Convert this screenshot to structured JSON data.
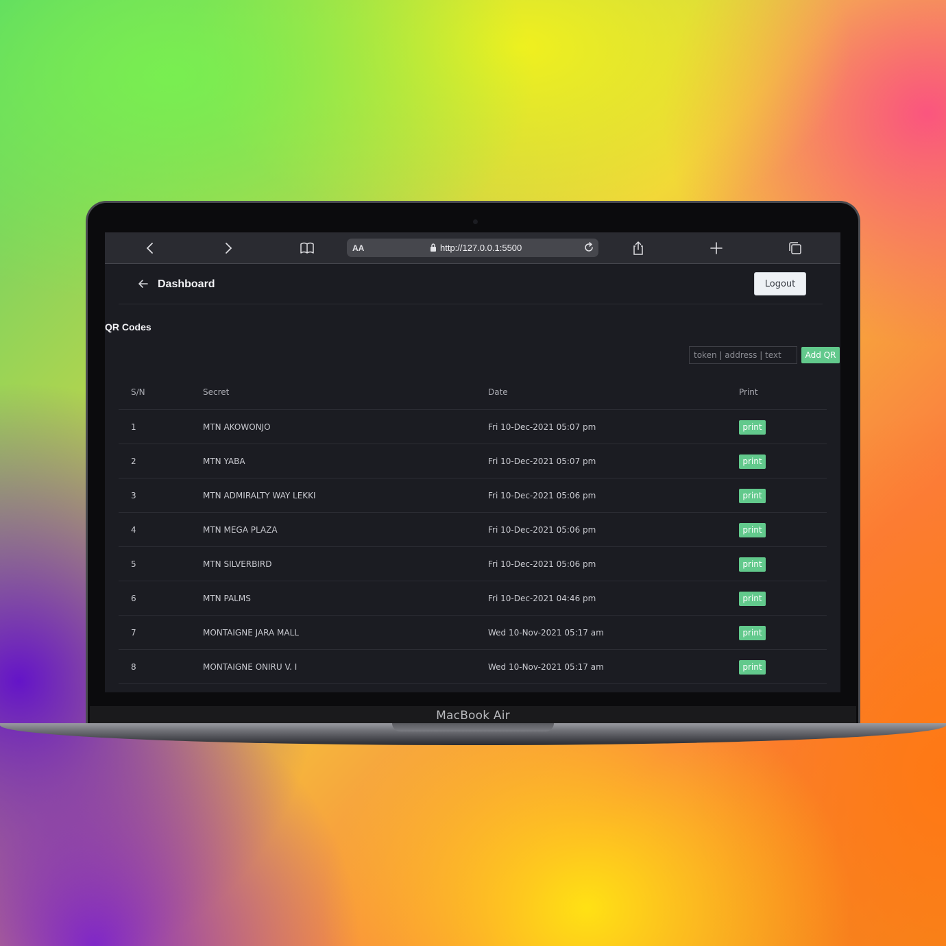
{
  "device": {
    "brand_label": "MacBook Air"
  },
  "browser": {
    "text_size_label": "AA",
    "url": "http://127.0.0.1:5500"
  },
  "header": {
    "title": "Dashboard",
    "logout_label": "Logout"
  },
  "section": {
    "title": "QR Codes"
  },
  "form": {
    "placeholder": "token | address | text",
    "add_label": "Add QR"
  },
  "table": {
    "columns": [
      "S/N",
      "Secret",
      "Date",
      "Print"
    ],
    "rows": [
      {
        "sn": "1",
        "secret": "MTN AKOWONJO",
        "date": "Fri 10-Dec-2021 05:07 pm",
        "print": "print"
      },
      {
        "sn": "2",
        "secret": "MTN YABA",
        "date": "Fri 10-Dec-2021 05:07 pm",
        "print": "print"
      },
      {
        "sn": "3",
        "secret": "MTN ADMIRALTY WAY LEKKI",
        "date": "Fri 10-Dec-2021 05:06 pm",
        "print": "print"
      },
      {
        "sn": "4",
        "secret": "MTN MEGA PLAZA",
        "date": "Fri 10-Dec-2021 05:06 pm",
        "print": "print"
      },
      {
        "sn": "5",
        "secret": "MTN SILVERBIRD",
        "date": "Fri 10-Dec-2021 05:06 pm",
        "print": "print"
      },
      {
        "sn": "6",
        "secret": "MTN PALMS",
        "date": "Fri 10-Dec-2021 04:46 pm",
        "print": "print"
      },
      {
        "sn": "7",
        "secret": "MONTAIGNE JARA MALL",
        "date": "Wed 10-Nov-2021 05:17 am",
        "print": "print"
      },
      {
        "sn": "8",
        "secret": "MONTAIGNE ONIRU V. I",
        "date": "Wed 10-Nov-2021 05:17 am",
        "print": "print"
      }
    ]
  },
  "icons": {
    "browser_back": "chevron-left-icon",
    "browser_forward": "chevron-right-icon",
    "bookmarks": "book-icon",
    "lock": "lock-icon",
    "reload": "reload-icon",
    "share": "share-icon",
    "new_tab": "plus-icon",
    "tabs": "tabs-icon",
    "page_back": "arrow-left-icon"
  },
  "colors": {
    "accent": "#62c98c",
    "screen_bg": "#1b1c22",
    "browser_bar": "#2a2b31"
  }
}
